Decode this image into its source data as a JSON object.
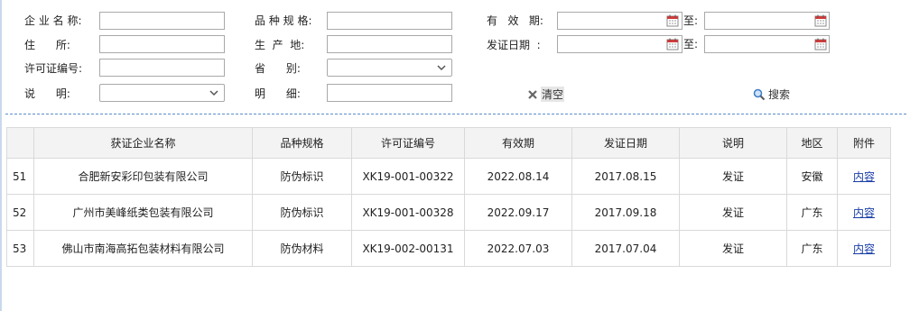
{
  "form": {
    "company_name_label": "企 业 名 称:",
    "address_label": "住      所:",
    "license_no_label": "许可证编号:",
    "description_label": "说      明:",
    "spec_label": "品 种 规 格:",
    "origin_label": "生  产  地:",
    "province_label": "省      别:",
    "detail_label": "明      细:",
    "validity_label": "有   效   期:",
    "issue_date_label": "发证日期  :",
    "to_label": "至:",
    "company_name_value": "",
    "address_value": "",
    "license_no_value": "",
    "spec_value": "",
    "origin_value": "",
    "detail_value": "",
    "description_selected": "",
    "province_selected": "",
    "validity_from": "",
    "validity_to": "",
    "issue_from": "",
    "issue_to": "",
    "clear_label": "清空",
    "search_label": "搜索"
  },
  "table": {
    "headers": [
      "",
      "获证企业名称",
      "品种规格",
      "许可证编号",
      "有效期",
      "发证日期",
      "说明",
      "地区",
      "附件"
    ],
    "rows": [
      [
        "51",
        "合肥新安彩印包装有限公司",
        "防伪标识",
        "XK19-001-00322",
        "2022.08.14",
        "2017.08.15",
        "发证",
        "安徽",
        "内容"
      ],
      [
        "52",
        "广州市美峰纸类包装有限公司",
        "防伪标识",
        "XK19-001-00328",
        "2022.09.17",
        "2017.09.18",
        "发证",
        "广东",
        "内容"
      ],
      [
        "53",
        "佛山市南海高拓包装材料有限公司",
        "防伪材料",
        "XK19-002-00131",
        "2022.07.03",
        "2017.07.04",
        "发证",
        "广东",
        "内容"
      ]
    ]
  },
  "icons": {
    "calendar": "calendar-icon",
    "clear": "clear-x-icon",
    "search": "magnifier-icon",
    "dropdown": "chevron-down-icon"
  },
  "colors": {
    "dashed_rule": "#5b8ec9",
    "header_bg": "#f3f3f3",
    "link": "#1a3ea8",
    "calendar_red": "#d23c3c"
  }
}
